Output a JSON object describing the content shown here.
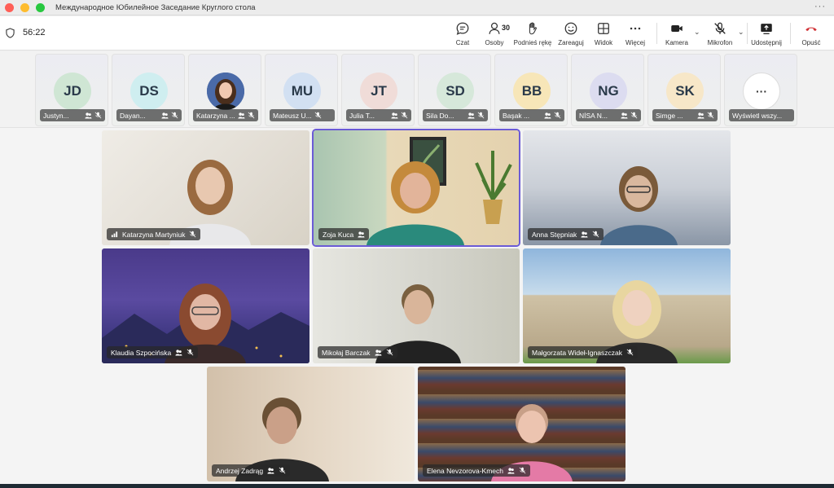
{
  "window": {
    "title": "Международное Юбилейное Заседание Круглого стола",
    "more": "···"
  },
  "toolbar": {
    "timer": "56:22",
    "buttons": [
      {
        "label": "Czat",
        "icon": "chat-icon"
      },
      {
        "label": "Osoby",
        "icon": "people-icon",
        "count": "30"
      },
      {
        "label": "Podnieś rękę",
        "icon": "raise-hand-icon"
      },
      {
        "label": "Zareaguj",
        "icon": "smiley-icon"
      },
      {
        "label": "Widok",
        "icon": "grid-view-icon"
      },
      {
        "label": "Więcej",
        "icon": "more-icon"
      },
      {
        "label": "Kamera",
        "icon": "camera-icon"
      },
      {
        "label": "Mikrofon",
        "icon": "microphone-muted-icon"
      },
      {
        "label": "Udostępnij",
        "icon": "share-screen-icon"
      },
      {
        "label": "Opuść",
        "icon": "leave-call-icon"
      }
    ]
  },
  "strip": [
    {
      "initials": "JD",
      "name": "Justyn...",
      "color": "#cfe6d4"
    },
    {
      "initials": "DS",
      "name": "Dayan...",
      "color": "#cfeef0"
    },
    {
      "initials": "",
      "name": "Katarzyna ...",
      "color": "#3a5a9a"
    },
    {
      "initials": "MU",
      "name": "Mateusz U...",
      "color": "#d2e0f2"
    },
    {
      "initials": "JT",
      "name": "Julia T...",
      "color": "#f0dcd8"
    },
    {
      "initials": "SD",
      "name": "Sila Do...",
      "color": "#d6e8da"
    },
    {
      "initials": "BB",
      "name": "Başak ...",
      "color": "#f7e6b8"
    },
    {
      "initials": "NG",
      "name": "NİSA N...",
      "color": "#dcdcf0"
    },
    {
      "initials": "SK",
      "name": "Simge ...",
      "color": "#f7e7c8"
    },
    {
      "initials": "···",
      "name": "Wyświetl wszy...",
      "color": "#ffffff"
    }
  ],
  "tiles": [
    {
      "name": "Katarzyna Martyniuk",
      "bg": "#e6e3de",
      "skin": "#e8c8b0",
      "hair": "#9a6a40",
      "shirt": "#e8e8ea"
    },
    {
      "name": "Zoja Kuca",
      "bg": "#c9bfa8",
      "skin": "#e2b49a",
      "hair": "#c48a3c",
      "shirt": "#2a8a7c"
    },
    {
      "name": "Anna Stępniak",
      "bg": "#c7cbd2",
      "skin": "#d9b89e",
      "hair": "#7a5a3a",
      "shirt": "#4a6a8a"
    },
    {
      "name": "Klaudia Szpocińska",
      "bg": "#3a3a7a",
      "skin": "#e1b7a4",
      "hair": "#8a4a30",
      "shirt": "#3a2a2a"
    },
    {
      "name": "Mikołaj Barczak",
      "bg": "#dcdcd6",
      "skin": "#d9b59a",
      "hair": "#7a6040",
      "shirt": "#222222"
    },
    {
      "name": "Małgorzata Wideł-Ignaszczak",
      "bg": "#a9c2d9",
      "skin": "#efd2c0",
      "hair": "#e8d6a0",
      "shirt": "#2a2a2a"
    },
    {
      "name": "Andrzej Zadrąg",
      "bg": "#d8c9b6",
      "skin": "#caa088",
      "hair": "#6a5035",
      "shirt": "#2a2a2a"
    },
    {
      "name": "Elena Nevzorova-Kmech",
      "bg": "#5a4030",
      "skin": "#ecc4b0",
      "hair": "#c8a088",
      "shirt": "#e47aa6"
    }
  ]
}
